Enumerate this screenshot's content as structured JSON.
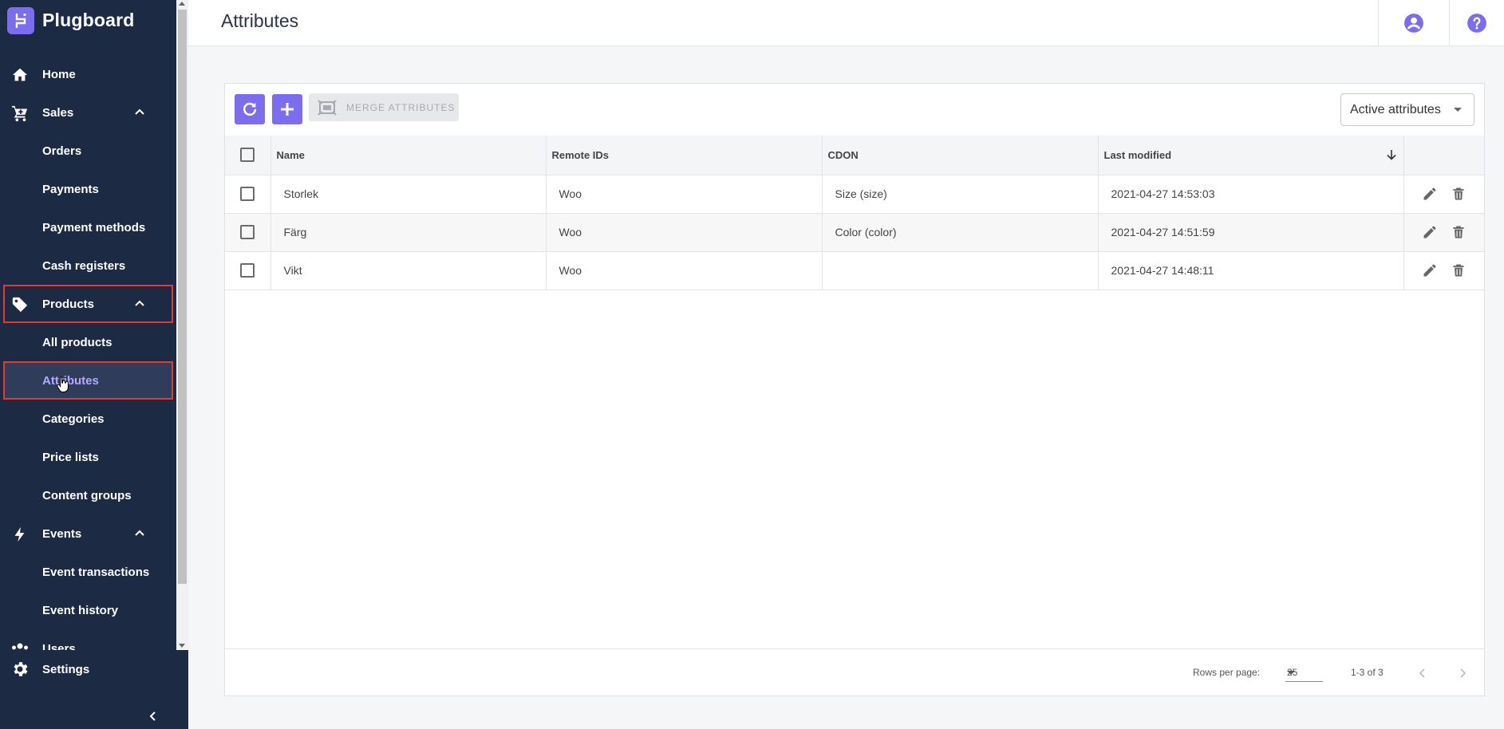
{
  "brand": {
    "name": "Plugboard",
    "accent": "#7c6cf0"
  },
  "sidebar": {
    "items": [
      {
        "label": "Home"
      },
      {
        "label": "Sales"
      },
      {
        "label": "Orders"
      },
      {
        "label": "Payments"
      },
      {
        "label": "Payment methods"
      },
      {
        "label": "Cash registers"
      },
      {
        "label": "Products"
      },
      {
        "label": "All products"
      },
      {
        "label": "Attributes"
      },
      {
        "label": "Categories"
      },
      {
        "label": "Price lists"
      },
      {
        "label": "Content groups"
      },
      {
        "label": "Events"
      },
      {
        "label": "Event transactions"
      },
      {
        "label": "Event history"
      },
      {
        "label": "Users"
      }
    ],
    "settings_label": "Settings",
    "active_color": "#b4a9ff",
    "highlight_color": "#e53935"
  },
  "header": {
    "title": "Attributes"
  },
  "toolbar": {
    "merge_label": "MERGE ATTRIBUTES",
    "filter_value": "Active attributes"
  },
  "table": {
    "columns": [
      "Name",
      "Remote IDs",
      "CDON",
      "Last modified"
    ],
    "rows": [
      {
        "name": "Storlek",
        "remote": "Woo",
        "cdon": "Size (size)",
        "modified": "2021-04-27 14:53:03"
      },
      {
        "name": "Färg",
        "remote": "Woo",
        "cdon": "Color (color)",
        "modified": "2021-04-27 14:51:59"
      },
      {
        "name": "Vikt",
        "remote": "Woo",
        "cdon": "",
        "modified": "2021-04-27 14:48:11"
      }
    ]
  },
  "footer": {
    "rows_per_page_label": "Rows per page:",
    "rows_per_page_value": "25",
    "range_text": "1-3 of 3"
  }
}
